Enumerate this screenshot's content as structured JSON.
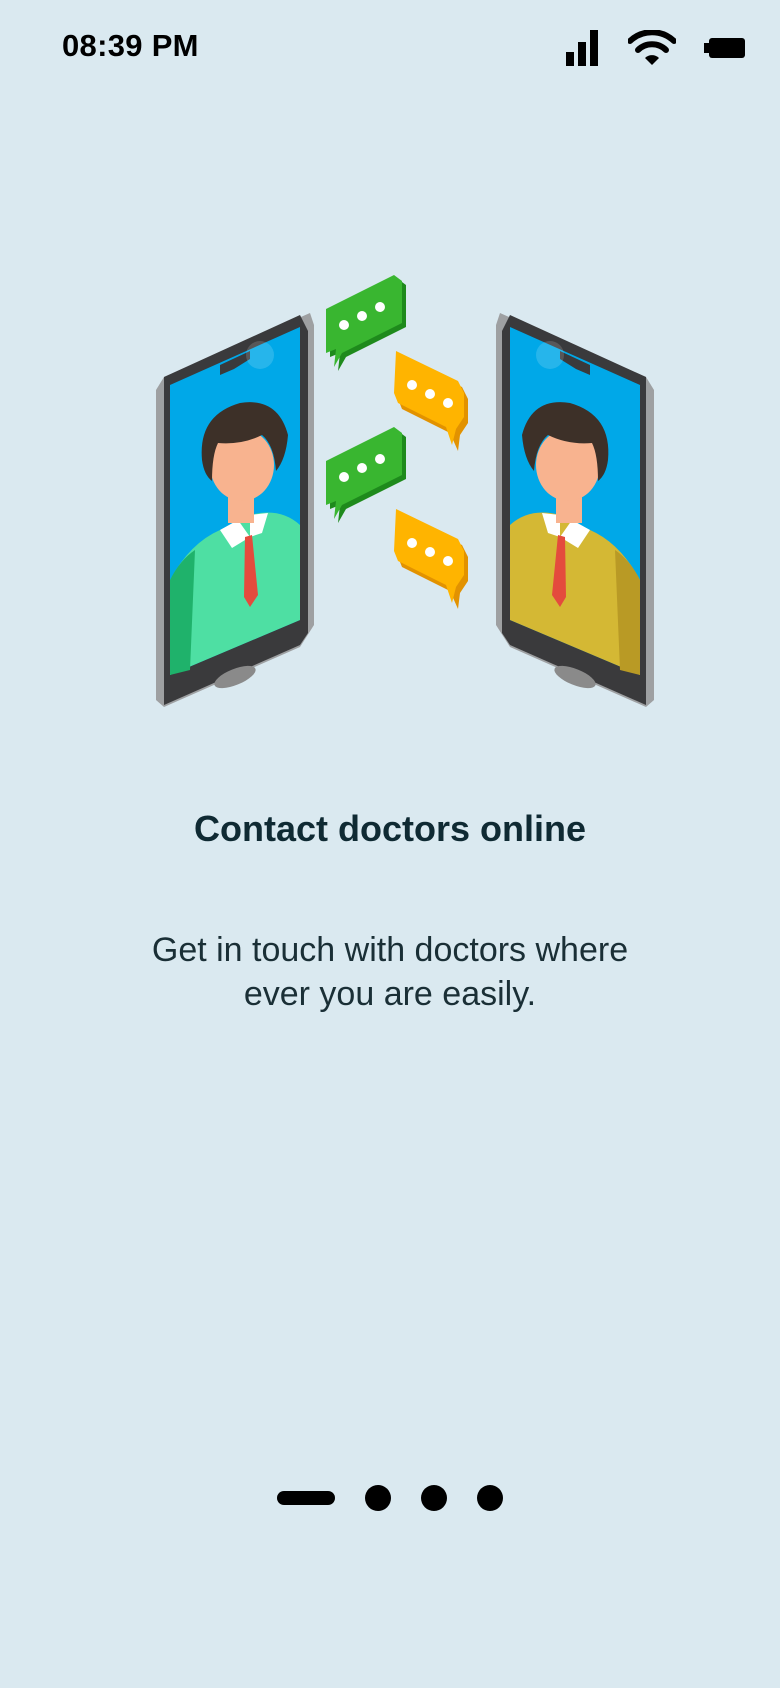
{
  "status_bar": {
    "time": "08:39 PM",
    "icons": [
      "signal-icon",
      "wifi-icon",
      "battery-icon"
    ]
  },
  "illustration": {
    "name": "video-consultation-illustration",
    "colors": {
      "screen": "#00a8e8",
      "left_shirt": "#4edfa3",
      "right_shirt": "#d4b834",
      "green_bubble": "#2fa02a",
      "orange_bubble": "#ffb400"
    }
  },
  "onboarding": {
    "title": "Contact doctors online",
    "description_line1": "Get in touch with doctors where",
    "description_line2": "ever you are easily."
  },
  "pager": {
    "total": 4,
    "active_index": 0
  },
  "colors": {
    "background": "#dae9f0",
    "text": "#0f2a33"
  }
}
